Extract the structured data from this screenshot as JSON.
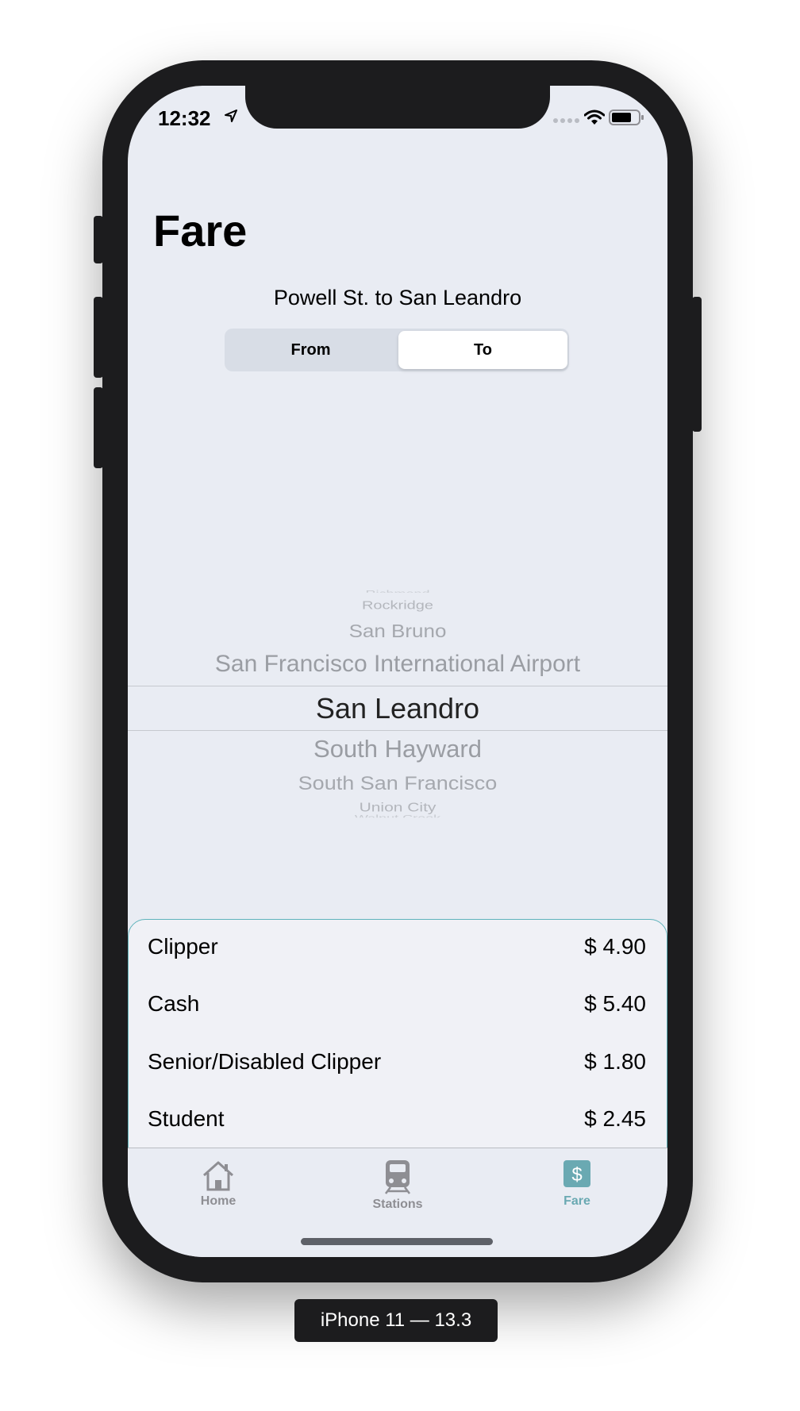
{
  "status_bar": {
    "time": "12:32"
  },
  "page": {
    "title": "Fare",
    "route": "Powell St. to San Leandro"
  },
  "segmented": {
    "from_label": "From",
    "to_label": "To",
    "selected": "To"
  },
  "picker": {
    "above": [
      "Richmond",
      "Rockridge",
      "San Bruno",
      "San Francisco International Airport"
    ],
    "selected": "San Leandro",
    "below": [
      "South Hayward",
      "South San Francisco",
      "Union City",
      "Walnut Creek"
    ]
  },
  "fares": [
    {
      "label": "Clipper",
      "price": "$ 4.90"
    },
    {
      "label": "Cash",
      "price": "$ 5.40"
    },
    {
      "label": "Senior/Disabled Clipper",
      "price": "$ 1.80"
    },
    {
      "label": "Student",
      "price": "$ 2.45"
    }
  ],
  "tabs": [
    {
      "label": "Home",
      "icon": "house-icon",
      "active": false
    },
    {
      "label": "Stations",
      "icon": "train-icon",
      "active": false
    },
    {
      "label": "Fare",
      "icon": "dollar-icon",
      "active": true
    }
  ],
  "device_label": "iPhone 11 — 13.3",
  "colors": {
    "accent": "#6aa9b2",
    "inactive": "#8e8e93",
    "background": "#e9ecf3",
    "card_border": "#5fb3bb"
  }
}
